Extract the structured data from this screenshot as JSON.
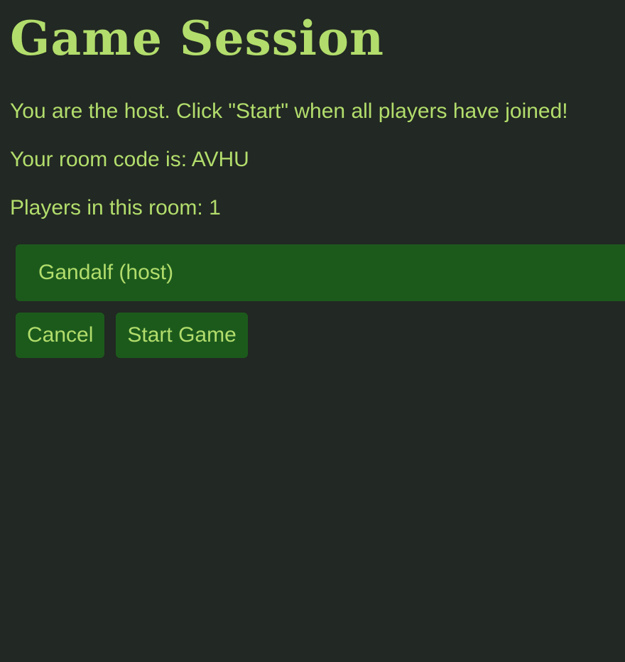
{
  "page": {
    "title": "Game Session"
  },
  "session": {
    "host_message": "You are the host. Click \"Start\" when all players have joined!",
    "room_code_label": "Your room code is:",
    "room_code": "AVHU",
    "players_label": "Players in this room:",
    "player_count": "1"
  },
  "players": [
    {
      "name": "Gandalf (host)"
    }
  ],
  "actions": {
    "cancel_label": "Cancel",
    "start_label": "Start Game"
  },
  "colors": {
    "background": "#222823",
    "text": "#b2dd6c",
    "surface": "#1c5a1c"
  }
}
